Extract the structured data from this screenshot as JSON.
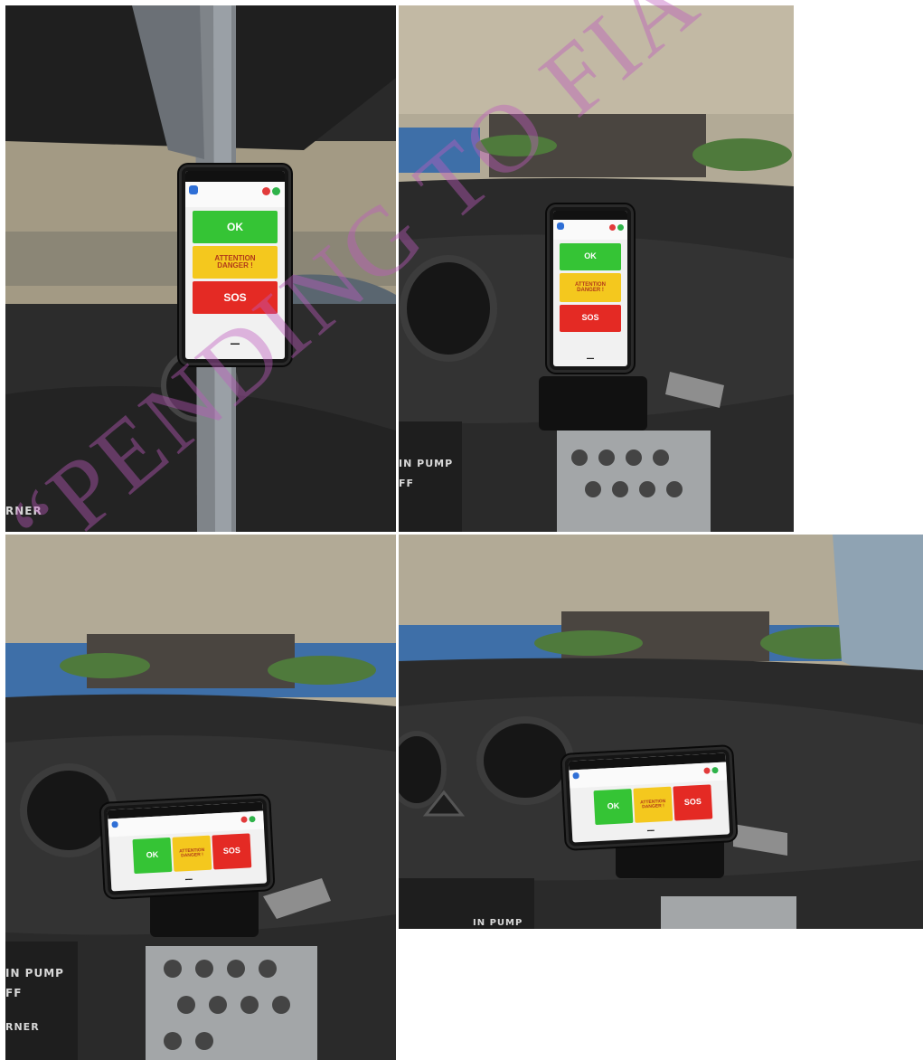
{
  "app": {
    "ok_label": "OK",
    "attention_line1": "ATTENTION",
    "attention_line2": "DANGER !",
    "sos_label": "SOS"
  },
  "panel_text": {
    "pump_tl": "IN PUMP",
    "off_tl": "FF",
    "corner_tl": "RNER",
    "pump_bl": "IN PUMP",
    "off_bl": "FF",
    "corner_bl": "RNER",
    "pump_br": "IN PUMP"
  },
  "watermark": "“PENDING TO FIA VISA”",
  "colors": {
    "ok": "#35c435",
    "attention": "#f4c81e",
    "sos": "#e42a24",
    "watermark": "#be5abe"
  }
}
